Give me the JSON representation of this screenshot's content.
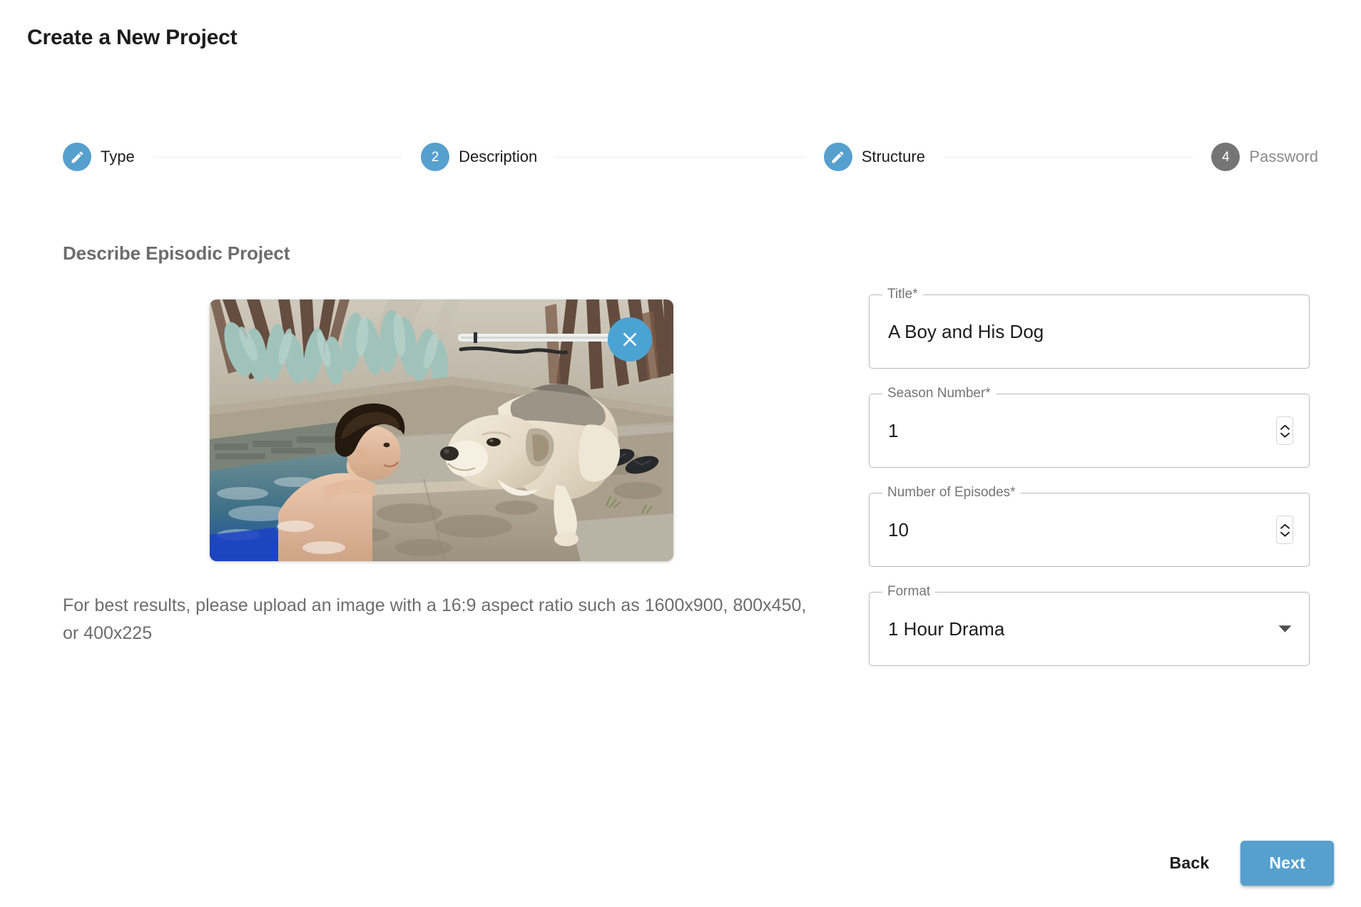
{
  "page": {
    "title": "Create a New Project",
    "section_heading": "Describe Episodic Project"
  },
  "stepper": {
    "steps": [
      {
        "label": "Type",
        "marker": "pencil-icon",
        "state": "complete",
        "color": "#56a0ce"
      },
      {
        "label": "Description",
        "marker": "2",
        "state": "active",
        "color": "#56a0ce"
      },
      {
        "label": "Structure",
        "marker": "pencil-icon",
        "state": "complete",
        "color": "#56a0ce"
      },
      {
        "label": "Password",
        "marker": "4",
        "state": "upcoming",
        "color": "#757575"
      }
    ]
  },
  "upload": {
    "image_alt": "Boy in a pool facing a dog lying on the pool deck",
    "remove_button_label": "Remove image",
    "remove_icon": "close-icon",
    "hint": "For best results, please upload an image with a 16:9 aspect ratio such as 1600x900, 800x450, or 400x225"
  },
  "form": {
    "fields": [
      {
        "name": "title",
        "legend": "Title*",
        "value": "A Boy and His Dog",
        "placeholder": "",
        "control": "text"
      },
      {
        "name": "season-number",
        "legend": "Season Number*",
        "value": "1",
        "placeholder": "",
        "control": "number"
      },
      {
        "name": "number-of-episodes",
        "legend": "Number of Episodes*",
        "value": "10",
        "placeholder": "",
        "control": "number"
      },
      {
        "name": "format",
        "legend": "Format",
        "value": "1 Hour Drama",
        "placeholder": "",
        "control": "select"
      }
    ]
  },
  "footer": {
    "back_label": "Back",
    "next_label": "Next"
  },
  "colors": {
    "accent_blue": "#56a0ce",
    "close_button_blue": "#4ba3d3",
    "inactive_gray": "#757575",
    "heading_gray": "#6d6d6d",
    "border_gray": "#b9b9b9",
    "connector_gray": "#ececec"
  }
}
